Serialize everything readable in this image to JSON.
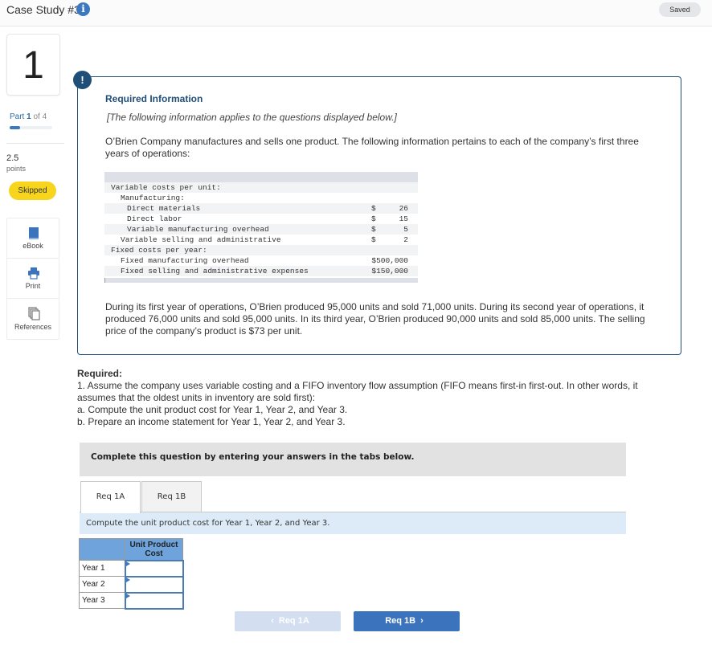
{
  "header": {
    "title": "Case Study #3",
    "info_icon": "info-icon",
    "status": "Saved"
  },
  "sidebar": {
    "question_number": "1",
    "part_prefix": "Part",
    "part_current": "1",
    "part_suffix": "of 4",
    "progress_fraction": 0.25,
    "points_value": "2.5",
    "points_label": "points",
    "status_badge": "Skipped",
    "tools": [
      {
        "label": "eBook",
        "icon": "book-icon"
      },
      {
        "label": "Print",
        "icon": "printer-icon"
      },
      {
        "label": "References",
        "icon": "documents-icon"
      }
    ]
  },
  "info": {
    "alert_icon": "!",
    "title": "Required Information",
    "note": "[The following information applies to the questions displayed below.]",
    "intro": "O’Brien Company manufactures and sells one product. The following information pertains to each of the company’s first three years of operations:",
    "cost_rows": [
      {
        "label": "Variable costs per unit:",
        "indent": 0,
        "currency": "",
        "amount": ""
      },
      {
        "label": "Manufacturing:",
        "indent": 1,
        "currency": "",
        "amount": ""
      },
      {
        "label": "Direct materials",
        "indent": 2,
        "currency": "$",
        "amount": "26"
      },
      {
        "label": "Direct labor",
        "indent": 2,
        "currency": "$",
        "amount": "15"
      },
      {
        "label": "Variable manufacturing overhead",
        "indent": 2,
        "currency": "$",
        "amount": "5"
      },
      {
        "label": "Variable selling and administrative",
        "indent": 1,
        "currency": "$",
        "amount": "2"
      },
      {
        "label": "Fixed costs per year:",
        "indent": 0,
        "currency": "",
        "amount": ""
      },
      {
        "label": "Fixed manufacturing overhead",
        "indent": 1,
        "currency": "",
        "amount": "$500,000"
      },
      {
        "label": "Fixed selling and administrative expenses",
        "indent": 1,
        "currency": "",
        "amount": "$150,000"
      }
    ],
    "paragraph": "During its first year of operations, O’Brien produced 95,000 units and sold 71,000 units. During its second year of operations, it produced 76,000 units and sold 95,000 units. In its third year, O’Brien produced 90,000 units and sold 85,000 units. The selling price of the company’s product is $73 per unit."
  },
  "required": {
    "title": "Required:",
    "lines": [
      "1. Assume the company uses variable costing and a FIFO inventory flow assumption (FIFO means first-in first-out. In other words, it assumes that the oldest units in inventory are sold first):",
      "a. Compute the unit product cost for Year 1, Year 2, and Year 3.",
      "b. Prepare an income statement for Year 1, Year 2, and Year 3."
    ]
  },
  "question": {
    "complete_instruction": "Complete this question by entering your answers in the tabs below.",
    "tabs": [
      {
        "label": "Req 1A",
        "active": true
      },
      {
        "label": "Req 1B",
        "active": false
      }
    ],
    "tab_instruction": "Compute the unit product cost for Year 1, Year 2, and Year 3.",
    "table": {
      "column_header": "Unit Product Cost",
      "rows": [
        {
          "label": "Year 1",
          "value": ""
        },
        {
          "label": "Year 2",
          "value": ""
        },
        {
          "label": "Year 3",
          "value": ""
        }
      ]
    },
    "nav": {
      "prev_label": "Req 1A",
      "next_label": "Req 1B",
      "prev_disabled": true
    }
  },
  "colors": {
    "accent_blue": "#3b74bd",
    "info_border": "#1f4e79",
    "skipped_yellow": "#f7d51d",
    "table_header": "#6ea3dc",
    "instruction_bg": "#dcebf7"
  }
}
